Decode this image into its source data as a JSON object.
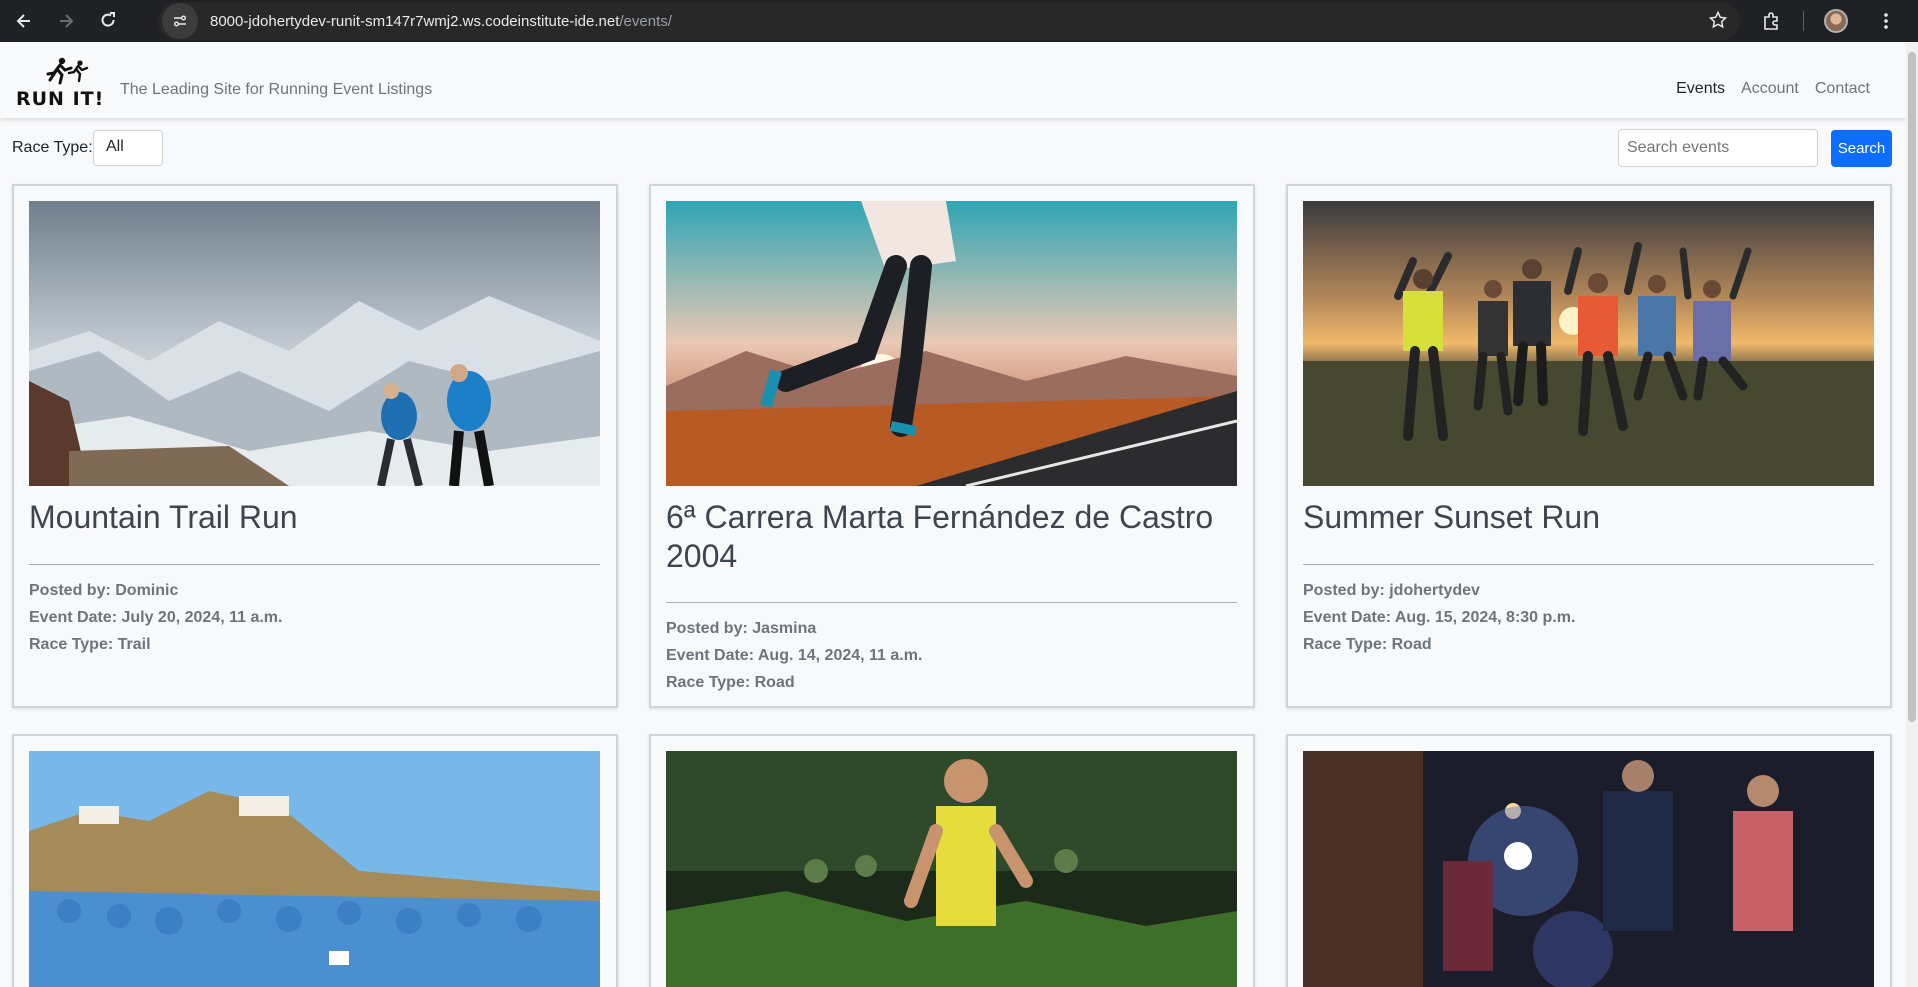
{
  "browser": {
    "url_host": "8000-jdohertydev-runit-sm147r7wmj2.ws.codeinstitute-ide.net",
    "url_path": "/events/"
  },
  "site": {
    "logo_text": "RUN IT!",
    "tagline": "The Leading Site for Running Event Listings",
    "nav": [
      "Events",
      "Account",
      "Contact"
    ]
  },
  "filters": {
    "race_type_label": "Race Type:",
    "race_type_value": "All",
    "search_placeholder": "Search events",
    "search_button": "Search"
  },
  "events": [
    {
      "title": "Mountain Trail Run",
      "posted_by": "Posted by: Dominic",
      "event_date": "Event Date: July 20, 2024, 11 a.m.",
      "race_type": "Race Type: Trail"
    },
    {
      "title": "6ª Carrera Marta Fernández de Castro 2004",
      "posted_by": "Posted by: Jasmina",
      "event_date": "Event Date: Aug. 14, 2024, 11 a.m.",
      "race_type": "Race Type: Road"
    },
    {
      "title": "Summer Sunset Run",
      "posted_by": "Posted by: jdohertydev",
      "event_date": "Event Date: Aug. 15, 2024, 8:30 p.m.",
      "race_type": "Race Type: Road"
    }
  ],
  "colors": {
    "primary_button": "#0d6efd",
    "title_text": "#3d4650",
    "muted_text": "#6c757d"
  }
}
